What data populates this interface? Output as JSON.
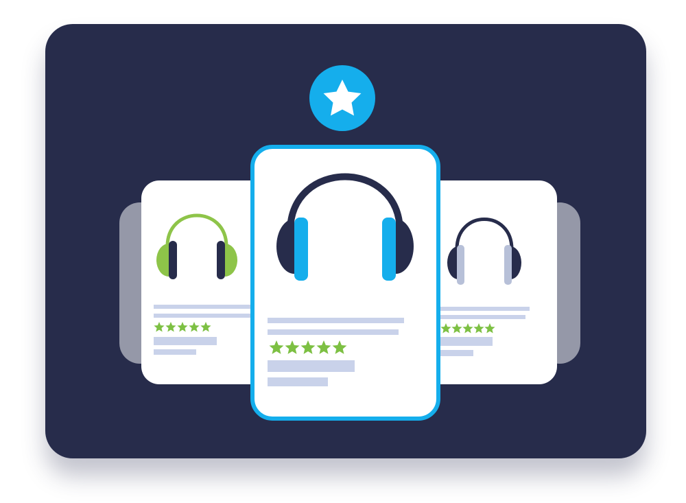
{
  "colors": {
    "panel": "#272c4b",
    "card": "#ffffff",
    "back_card": "#9598a8",
    "accent_blue": "#15aeec",
    "accent_green": "#8ec449",
    "headphone_band": "#272c4b",
    "headphone_dark_cup": "#272c4b",
    "muted_cup": "#b7c0d8",
    "text_placeholder": "#c9d2ea",
    "star_green": "#7dc043",
    "badge_star": "#ffffff"
  },
  "cards": [
    {
      "position": "left",
      "headphone_style": "green",
      "rating": 5,
      "featured": false
    },
    {
      "position": "center",
      "headphone_style": "blue",
      "rating": 5,
      "featured": true
    },
    {
      "position": "right",
      "headphone_style": "muted",
      "rating": 5,
      "featured": false
    }
  ],
  "badge": {
    "icon": "star-icon"
  }
}
